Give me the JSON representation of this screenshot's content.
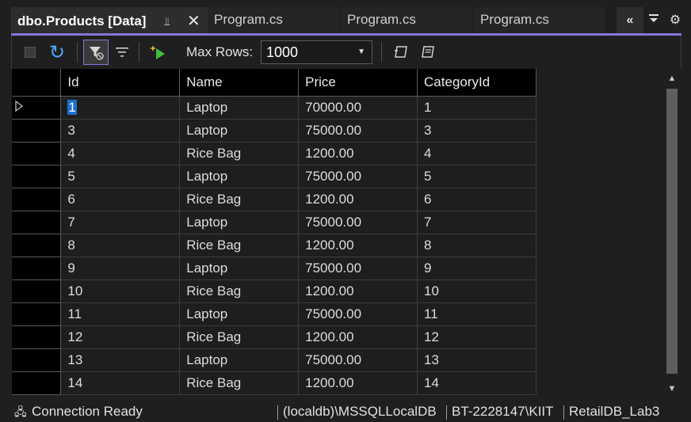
{
  "tabs": {
    "active": {
      "label": "dbo.Products [Data]"
    },
    "others": [
      "Program.cs",
      "Program.cs",
      "Program.cs"
    ]
  },
  "toolbar": {
    "max_rows_label": "Max Rows:",
    "max_rows_value": "1000"
  },
  "grid": {
    "columns": [
      "Id",
      "Name",
      "Price",
      "CategoryId"
    ],
    "rows": [
      [
        "1",
        "Laptop",
        "70000.00",
        "1"
      ],
      [
        "3",
        "Laptop",
        "75000.00",
        "3"
      ],
      [
        "4",
        "Rice Bag",
        "1200.00",
        "4"
      ],
      [
        "5",
        "Laptop",
        "75000.00",
        "5"
      ],
      [
        "6",
        "Rice Bag",
        "1200.00",
        "6"
      ],
      [
        "7",
        "Laptop",
        "75000.00",
        "7"
      ],
      [
        "8",
        "Rice Bag",
        "1200.00",
        "8"
      ],
      [
        "9",
        "Laptop",
        "75000.00",
        "9"
      ],
      [
        "10",
        "Rice Bag",
        "1200.00",
        "10"
      ],
      [
        "11",
        "Laptop",
        "75000.00",
        "11"
      ],
      [
        "12",
        "Rice Bag",
        "1200.00",
        "12"
      ],
      [
        "13",
        "Laptop",
        "75000.00",
        "13"
      ],
      [
        "14",
        "Rice Bag",
        "1200.00",
        "14"
      ]
    ]
  },
  "status": {
    "connection": "Connection Ready",
    "server": "(localdb)\\MSSQLLocalDB",
    "user": "BT-2228147\\KIIT",
    "database": "RetailDB_Lab3"
  },
  "colors": {
    "accent": "#8a74d8",
    "selection": "#1e6fcf",
    "background": "#1f1f1f"
  }
}
